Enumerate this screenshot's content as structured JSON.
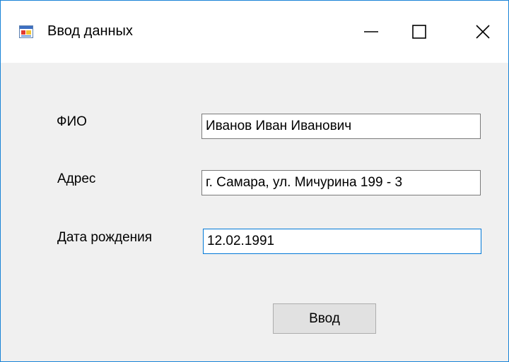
{
  "window": {
    "title": "Ввод данных",
    "icon": "windows-form-icon",
    "controls": {
      "minimize_icon": "minimize-icon",
      "maximize_icon": "maximize-icon",
      "close_icon": "close-icon"
    }
  },
  "form": {
    "fio_label": "ФИО",
    "fio_value": "Иванов Иван Иванович",
    "address_label": "Адрес",
    "address_value": "г. Самара, ул. Мичурина 199 - 3",
    "birthdate_label": "Дата рождения",
    "birthdate_value": "12.02.1991",
    "submit_label": "Ввод"
  },
  "colors": {
    "window_border": "#1883d7",
    "client_background": "#f0f0f0",
    "focus_border": "#0078d7",
    "button_face": "#e1e1e1"
  }
}
